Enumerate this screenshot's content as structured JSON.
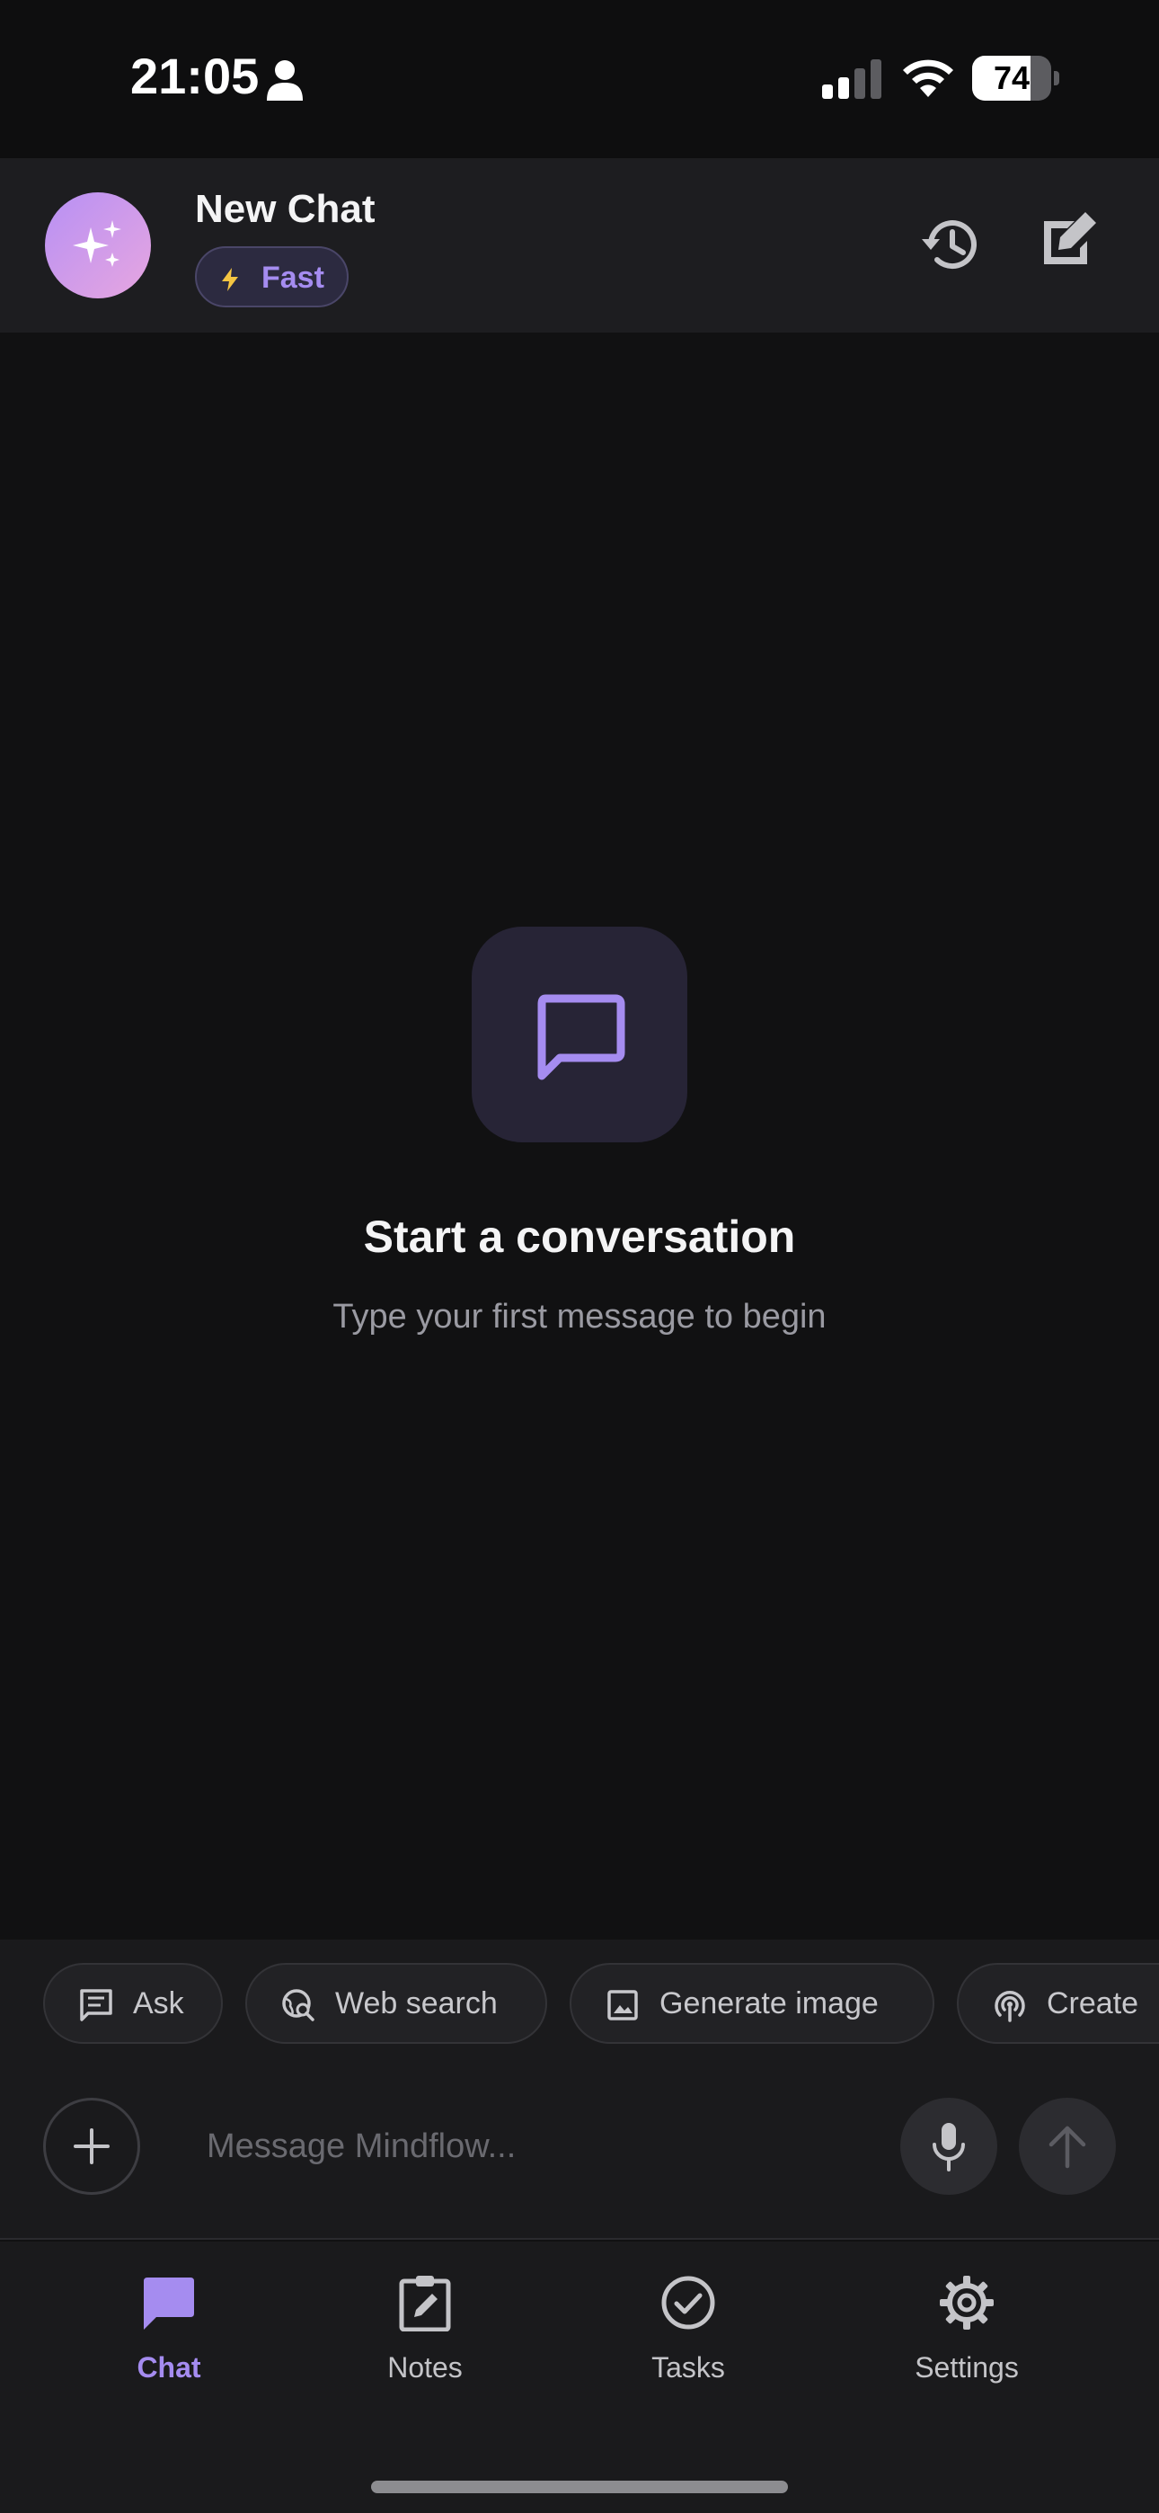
{
  "status_bar": {
    "time": "21:05",
    "battery_level": "74",
    "battery_fraction": 0.74
  },
  "header": {
    "title": "New Chat",
    "mode_label": "Fast",
    "avatar_gradient": [
      "#b790f4",
      "#e7a6e0"
    ]
  },
  "empty_state": {
    "title": "Start a conversation",
    "subtitle": "Type your first message to begin"
  },
  "quick_actions": [
    {
      "label": "Ask",
      "icon": "chat-lines-icon"
    },
    {
      "label": "Web search",
      "icon": "globe-search-icon"
    },
    {
      "label": "Generate image",
      "icon": "image-icon"
    },
    {
      "label": "Create",
      "icon": "podcast-icon"
    }
  ],
  "composer": {
    "placeholder": "Message Mindflow...",
    "value": ""
  },
  "bottom_nav": {
    "items": [
      {
        "label": "Chat",
        "icon": "chat-bubble-icon",
        "active": true
      },
      {
        "label": "Notes",
        "icon": "clipboard-edit-icon",
        "active": false
      },
      {
        "label": "Tasks",
        "icon": "check-circle-icon",
        "active": false
      },
      {
        "label": "Settings",
        "icon": "gear-icon",
        "active": false
      }
    ]
  },
  "colors": {
    "accent": "#a58cf0",
    "background": "#111112",
    "surface": "#1d1d20"
  }
}
